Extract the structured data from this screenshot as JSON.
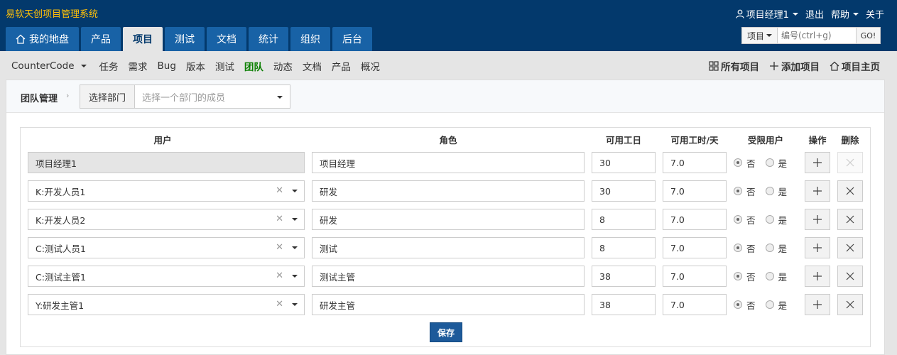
{
  "app": {
    "title": "易软天创项目管理系统"
  },
  "topbar": {
    "user": "项目经理1",
    "logout": "退出",
    "help": "帮助",
    "about": "关于"
  },
  "nav": [
    {
      "label": "我的地盘",
      "active": false
    },
    {
      "label": "产品",
      "active": false
    },
    {
      "label": "项目",
      "active": true
    },
    {
      "label": "测试",
      "active": false
    },
    {
      "label": "文档",
      "active": false
    },
    {
      "label": "统计",
      "active": false
    },
    {
      "label": "组织",
      "active": false
    },
    {
      "label": "后台",
      "active": false
    }
  ],
  "search": {
    "type": "项目",
    "placeholder": "编号(ctrl+g)",
    "go": "GO!"
  },
  "subnav": {
    "product": "CounterCode",
    "items": [
      "任务",
      "需求",
      "Bug",
      "版本",
      "测试",
      "团队",
      "动态",
      "文档",
      "产品",
      "概况"
    ],
    "active": "团队",
    "right": [
      "所有项目",
      "添加项目",
      "项目主页"
    ]
  },
  "breadcrumb": {
    "title": "团队管理",
    "dept_label": "选择部门",
    "dept_placeholder": "选择一个部门的成员"
  },
  "table": {
    "headers": [
      "用户",
      "角色",
      "可用工日",
      "可用工时/天",
      "受限用户",
      "操作",
      "删除"
    ],
    "radio_no": "否",
    "radio_yes": "是",
    "rows": [
      {
        "user": "项目经理1",
        "role": "项目经理",
        "days": "30",
        "hours": "7.0",
        "limited": false,
        "readonly": true
      },
      {
        "user": "K:开发人员1",
        "role": "研发",
        "days": "30",
        "hours": "7.0",
        "limited": false,
        "readonly": false
      },
      {
        "user": "K:开发人员2",
        "role": "研发",
        "days": "8",
        "hours": "7.0",
        "limited": false,
        "readonly": false
      },
      {
        "user": "C:测试人员1",
        "role": "测试",
        "days": "8",
        "hours": "7.0",
        "limited": false,
        "readonly": false
      },
      {
        "user": "C:测试主管1",
        "role": "测试主管",
        "days": "38",
        "hours": "7.0",
        "limited": false,
        "readonly": false
      },
      {
        "user": "Y:研发主管1",
        "role": "研发主管",
        "days": "38",
        "hours": "7.0",
        "limited": false,
        "readonly": false
      }
    ],
    "save_label": "保存"
  }
}
